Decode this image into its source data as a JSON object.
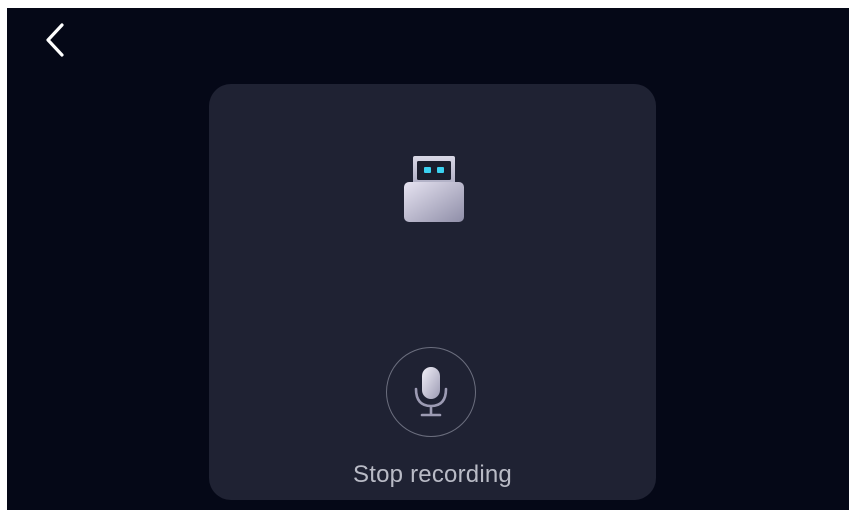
{
  "header": {
    "back_icon": "chevron-left-icon"
  },
  "card": {
    "device_icon": "usb-drive-icon",
    "mic_icon": "microphone-icon",
    "stop_label": "Stop recording"
  },
  "colors": {
    "background": "#050817",
    "card": "#1f2233",
    "indicator_lights": "#3bd1f0",
    "label_text": "#b9bbc6"
  }
}
